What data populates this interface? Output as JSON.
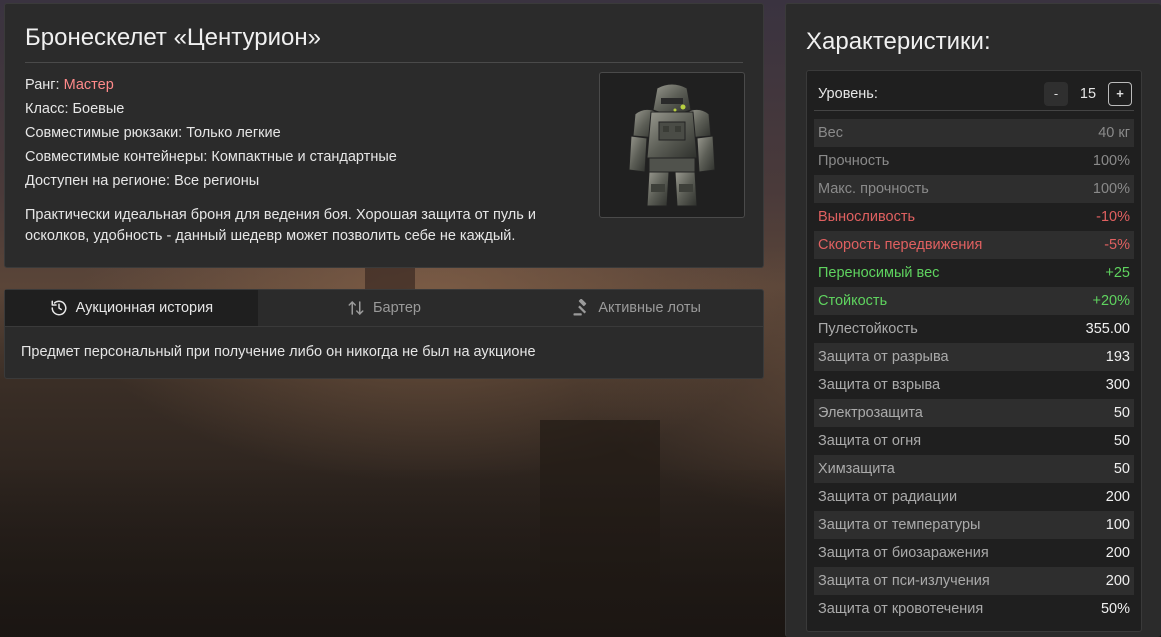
{
  "item": {
    "title": "Бронескелет «Центурион»",
    "rank_label": "Ранг: ",
    "rank_value": "Мастер",
    "rank_color": "#ff8a8a",
    "class": "Класс: Боевые",
    "backpacks": "Совместимые рюкзаки: Только легкие",
    "containers": "Совместимые контейнеры: Компактные и стандартные",
    "region": "Доступен на регионе: Все регионы",
    "description": "Практически идеальная броня для ведения боя. Хорошая защита от пуль и осколков, удобность - данный шедевр может позволить себе не каждый."
  },
  "tabs": [
    {
      "label": "Аукционная история",
      "icon": "history-icon",
      "active": true
    },
    {
      "label": "Бартер",
      "icon": "swap-arrows-icon",
      "active": false
    },
    {
      "label": "Активные лоты",
      "icon": "gavel-icon",
      "active": false
    }
  ],
  "history_message": "Предмет персональный при получение либо он никогда не был на аукционе",
  "stats": {
    "title": "Характеристики:",
    "level_label": "Уровень:",
    "level_minus": "-",
    "level_value": "15",
    "level_plus": "+",
    "rows": [
      {
        "name": "Вес",
        "value": "40 кг",
        "style": "muted"
      },
      {
        "name": "Прочность",
        "value": "100%",
        "style": "muted"
      },
      {
        "name": "Макс. прочность",
        "value": "100%",
        "style": "muted"
      },
      {
        "name": "Выносливость",
        "value": "-10%",
        "style": "neg"
      },
      {
        "name": "Скорость передвижения",
        "value": "-5%",
        "style": "neg"
      },
      {
        "name": "Переносимый вес",
        "value": "+25",
        "style": "pos"
      },
      {
        "name": "Стойкость",
        "value": "+20%",
        "style": "pos"
      },
      {
        "name": "Пулестойкость",
        "value": "355.00",
        "style": "normal"
      },
      {
        "name": "Защита от разрыва",
        "value": "193",
        "style": "normal"
      },
      {
        "name": "Защита от взрыва",
        "value": "300",
        "style": "normal"
      },
      {
        "name": "Электрозащита",
        "value": "50",
        "style": "normal"
      },
      {
        "name": "Защита от огня",
        "value": "50",
        "style": "normal"
      },
      {
        "name": "Химзащита",
        "value": "50",
        "style": "normal"
      },
      {
        "name": "Защита от радиации",
        "value": "200",
        "style": "normal"
      },
      {
        "name": "Защита от температуры",
        "value": "100",
        "style": "normal"
      },
      {
        "name": "Защита от биозаражения",
        "value": "200",
        "style": "normal"
      },
      {
        "name": "Защита от пси-излучения",
        "value": "200",
        "style": "normal"
      },
      {
        "name": "Защита от кровотечения",
        "value": "50%",
        "style": "normal"
      }
    ]
  },
  "colors": {
    "negative": "#e06060",
    "positive": "#5fd35f",
    "muted": "#8a8a8a"
  }
}
